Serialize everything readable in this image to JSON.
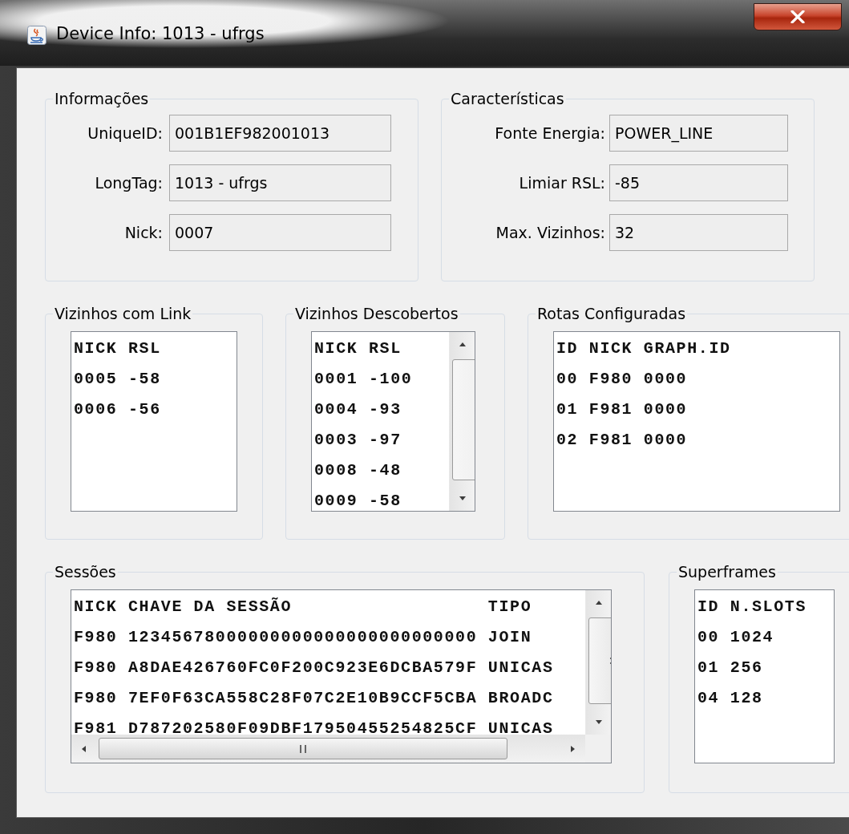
{
  "window": {
    "title": "Device Info: 1013 - ufrgs"
  },
  "informacoes": {
    "title": "Informações",
    "fields": [
      {
        "label": "UniqueID:",
        "value": "001B1EF982001013"
      },
      {
        "label": "LongTag:",
        "value": "1013 - ufrgs"
      },
      {
        "label": "Nick:",
        "value": "0007"
      }
    ]
  },
  "caracteristicas": {
    "title": "Características",
    "fields": [
      {
        "label": "Fonte Energia:",
        "value": "POWER_LINE"
      },
      {
        "label": "Limiar RSL:",
        "value": "-85"
      },
      {
        "label": "Max. Vizinhos:",
        "value": "32"
      }
    ]
  },
  "vizinhos_com_link": {
    "title": "Vizinhos com Link",
    "vertical_scrollbar": false,
    "horizontal_scrollbar": false,
    "lines": [
      "NICK RSL",
      "0005 -58",
      "0006 -56"
    ]
  },
  "vizinhos_descobertos": {
    "title": "Vizinhos Descobertos",
    "vertical_scrollbar": true,
    "horizontal_scrollbar": false,
    "lines": [
      "NICK RSL",
      "0001 -100",
      "0004 -93",
      "0003 -97",
      "0008 -48",
      "0009 -58"
    ]
  },
  "rotas_configuradas": {
    "title": "Rotas Configuradas",
    "vertical_scrollbar": false,
    "horizontal_scrollbar": false,
    "lines": [
      "ID NICK GRAPH.ID",
      "00 F980 0000",
      "01 F981 0000",
      "02 F981 0000"
    ]
  },
  "sessoes": {
    "title": "Sessões",
    "vertical_scrollbar": true,
    "horizontal_scrollbar": true,
    "lines": [
      "NICK CHAVE DA SESSÃO                  TIPO",
      "F980 12345678000000000000000000000000 JOIN",
      "F980 A8DAE426760FC0F200C923E6DCBA579F UNICAS",
      "F980 7EF0F63CA558C28F07C2E10B9CCF5CBA BROADC",
      "F981 D787202580F09DBF17950455254825CF UNICAS"
    ]
  },
  "superframes": {
    "title": "Superframes",
    "vertical_scrollbar": false,
    "horizontal_scrollbar": false,
    "lines": [
      "ID N.SLOTS",
      "00 1024",
      "01 256",
      "04 128"
    ]
  }
}
